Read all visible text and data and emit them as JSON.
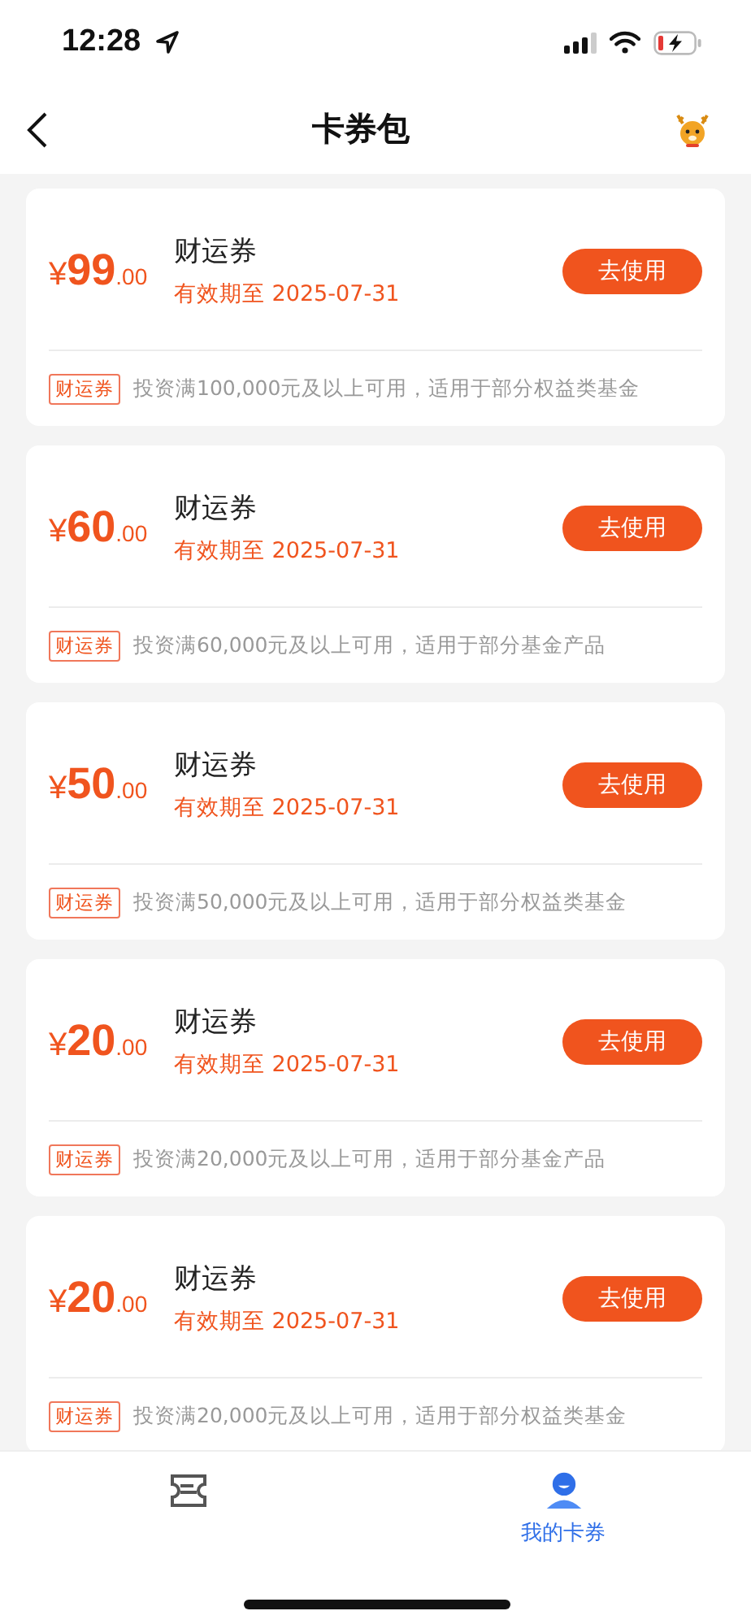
{
  "status_bar": {
    "time": "12:28"
  },
  "nav": {
    "title": "卡券包"
  },
  "coupons": [
    {
      "currency": "¥",
      "amount": "99",
      "decimals": ".00",
      "name": "财运券",
      "expiry": "有效期至 2025-07-31",
      "button": "去使用",
      "tag": "财运券",
      "condition": "投资满100,000元及以上可用，适用于部分权益类基金"
    },
    {
      "currency": "¥",
      "amount": "60",
      "decimals": ".00",
      "name": "财运券",
      "expiry": "有效期至 2025-07-31",
      "button": "去使用",
      "tag": "财运券",
      "condition": "投资满60,000元及以上可用，适用于部分基金产品"
    },
    {
      "currency": "¥",
      "amount": "50",
      "decimals": ".00",
      "name": "财运券",
      "expiry": "有效期至 2025-07-31",
      "button": "去使用",
      "tag": "财运券",
      "condition": "投资满50,000元及以上可用，适用于部分权益类基金"
    },
    {
      "currency": "¥",
      "amount": "20",
      "decimals": ".00",
      "name": "财运券",
      "expiry": "有效期至 2025-07-31",
      "button": "去使用",
      "tag": "财运券",
      "condition": "投资满20,000元及以上可用，适用于部分基金产品"
    },
    {
      "currency": "¥",
      "amount": "20",
      "decimals": ".00",
      "name": "财运券",
      "expiry": "有效期至 2025-07-31",
      "button": "去使用",
      "tag": "财运券",
      "condition": "投资满20,000元及以上可用，适用于部分权益类基金"
    }
  ],
  "tab_bar": [
    {
      "kind": "ticket",
      "selected": false
    },
    {
      "kind": "person",
      "label": "我的卡券",
      "selected": true
    }
  ]
}
